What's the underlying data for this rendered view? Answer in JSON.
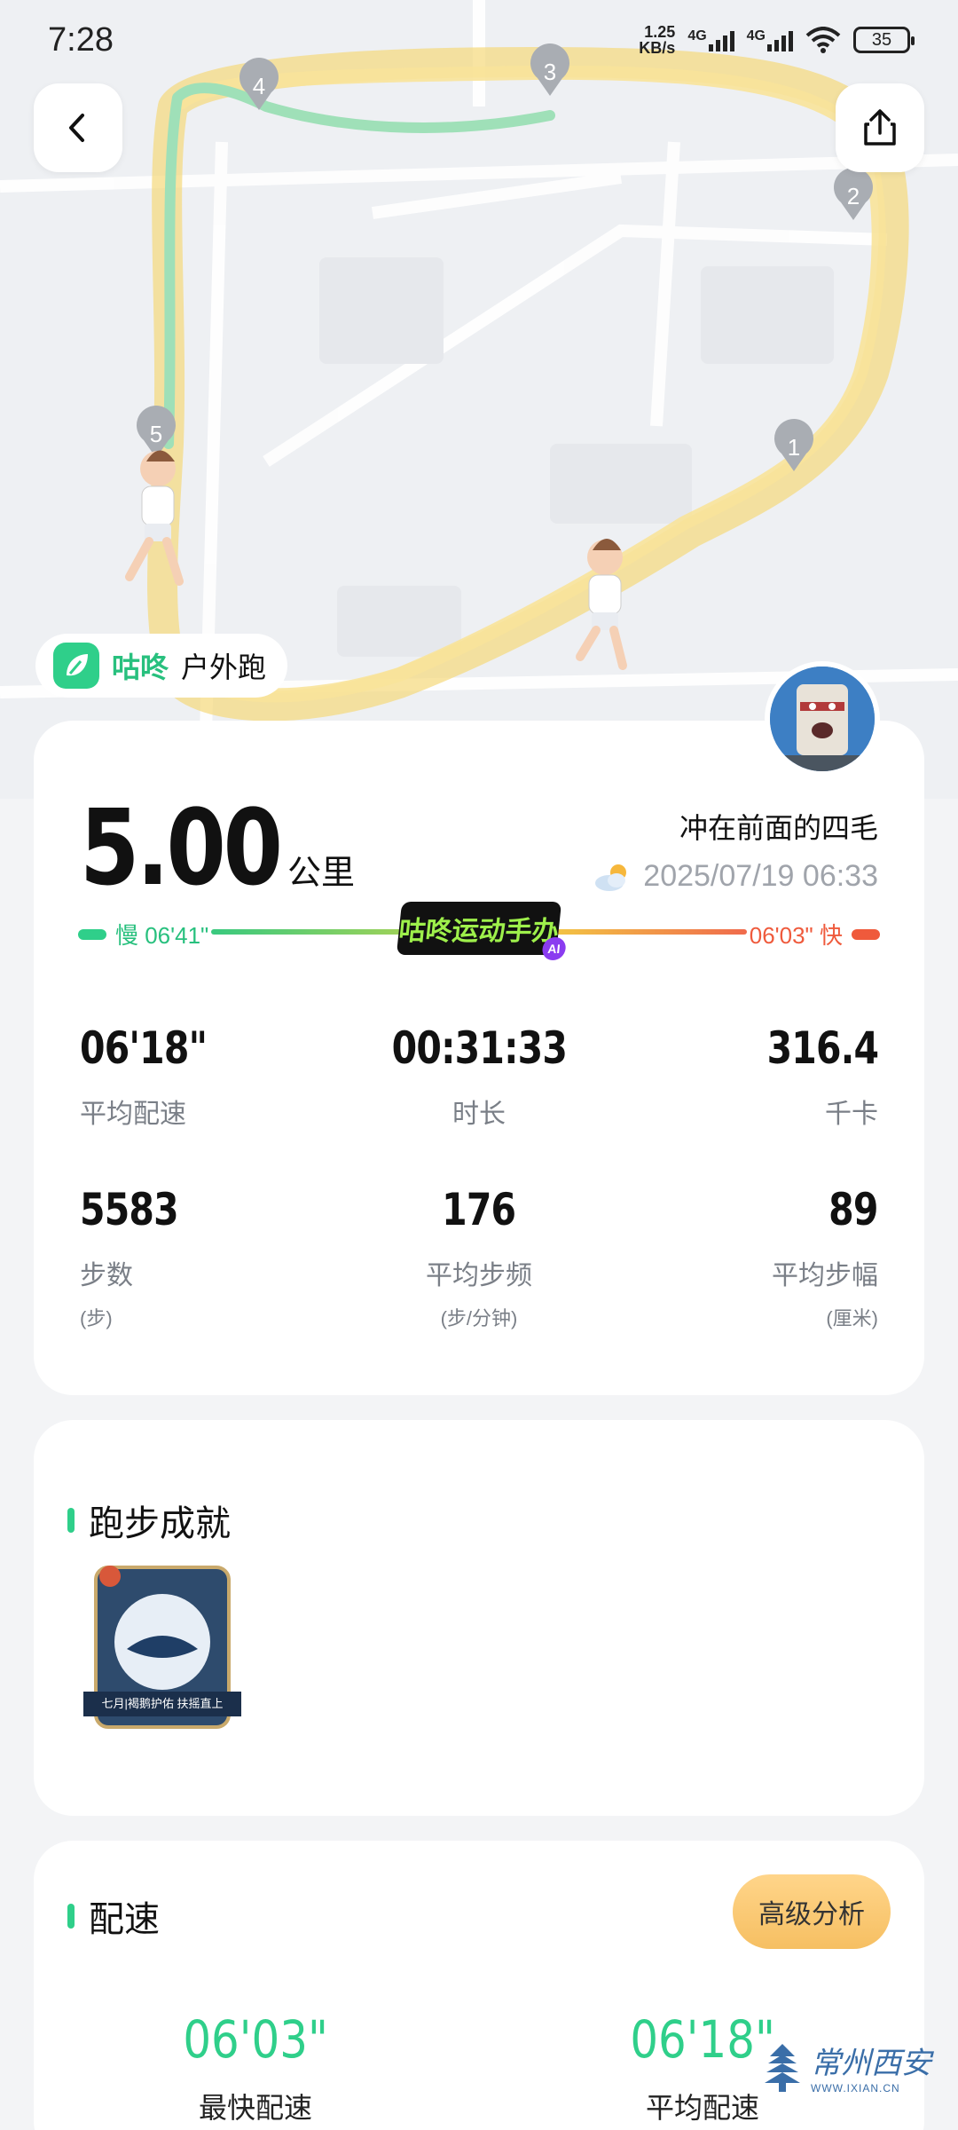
{
  "status_bar": {
    "time": "7:28",
    "net_speed_value": "1.25",
    "net_speed_unit": "KB/s",
    "sim1": "4G",
    "sim2": "4G",
    "battery": "35"
  },
  "map": {
    "markers": [
      "1",
      "2",
      "3",
      "4",
      "5"
    ]
  },
  "brand": {
    "name": "咕咚",
    "activity": "户外跑"
  },
  "summary": {
    "distance": "5.00",
    "distance_unit": "公里",
    "username": "冲在前面的四毛",
    "datetime": "2025/07/19 06:33",
    "slow_label": "慢 06'41\"",
    "fast_label": "06'03\" 快",
    "badge_text": "咕咚运动手办",
    "badge_ai": "AI"
  },
  "stats": [
    {
      "value": "06'18\"",
      "label": "平均配速",
      "sub": ""
    },
    {
      "value": "00:31:33",
      "label": "时长",
      "sub": ""
    },
    {
      "value": "316.4",
      "label": "千卡",
      "sub": ""
    },
    {
      "value": "5583",
      "label": "步数",
      "sub": "(步)"
    },
    {
      "value": "176",
      "label": "平均步频",
      "sub": "(步/分钟)"
    },
    {
      "value": "89",
      "label": "平均步幅",
      "sub": "(厘米)"
    }
  ],
  "achievements": {
    "title": "跑步成就",
    "medal_caption": "七月|褐鹅护佑 扶摇直上"
  },
  "pace": {
    "title": "配速",
    "advanced_button": "高级分析",
    "fastest_value": "06'03\"",
    "fastest_label": "最快配速",
    "average_value": "06'18\"",
    "average_label": "平均配速"
  },
  "watermark": {
    "text": "常州西安",
    "url": "WWW.IXIAN.CN"
  },
  "colors": {
    "accent_green": "#2fcf8a",
    "fast_red": "#ef5a3c",
    "route_yellow": "#f5d97a"
  }
}
